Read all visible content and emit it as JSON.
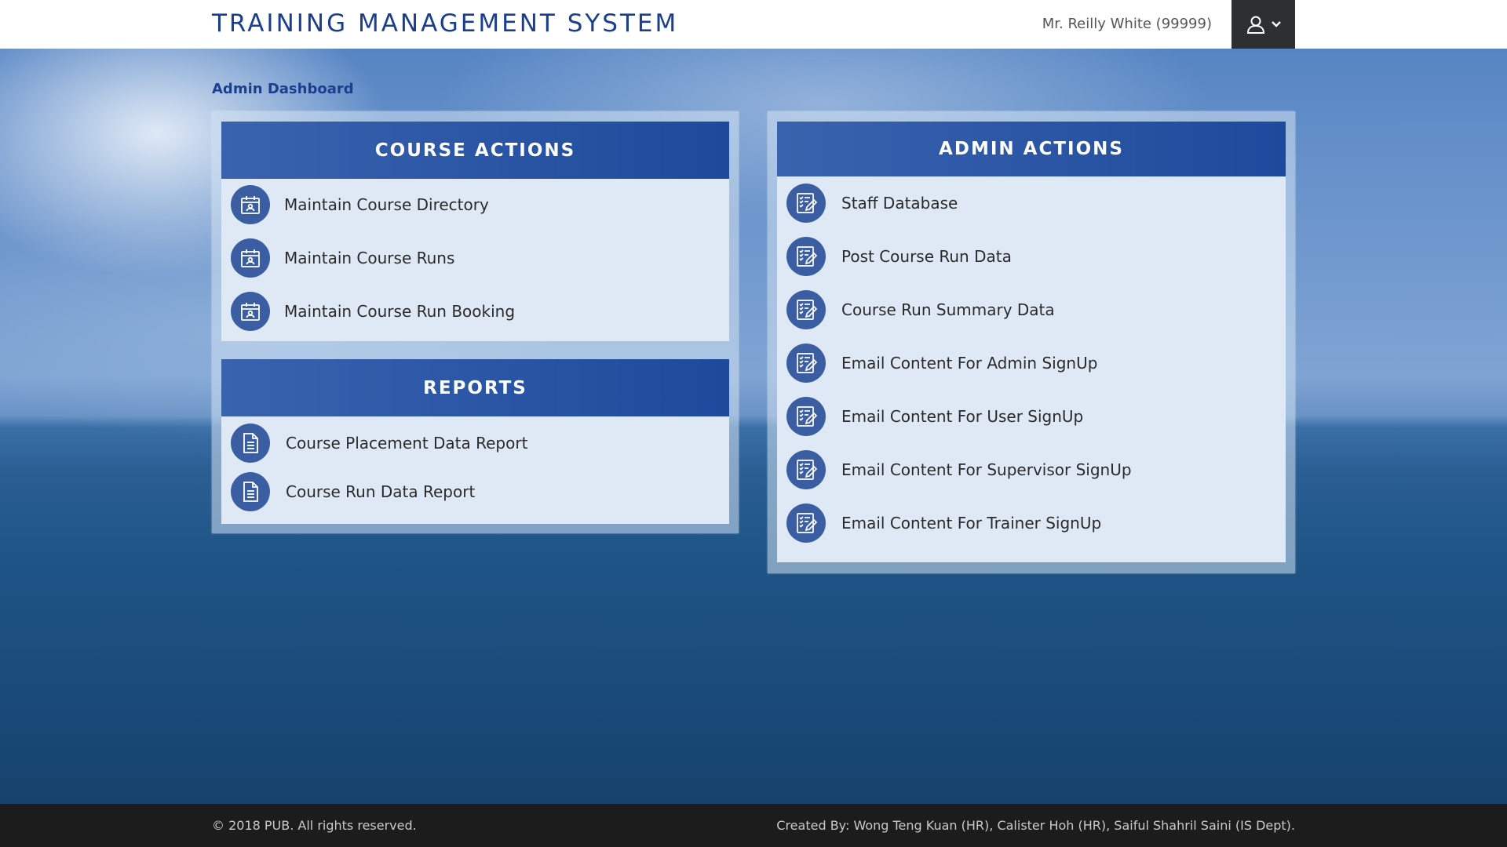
{
  "header": {
    "brand": "TRAINING MANAGEMENT SYSTEM",
    "user_name": "Mr. Reilly White (99999)",
    "user_menu_icon": "user-icon"
  },
  "page": {
    "title": "Admin Dashboard"
  },
  "course_actions": {
    "title": "COURSE ACTIONS",
    "items": [
      {
        "label": "Maintain Course Directory",
        "icon": "calendar-person-icon"
      },
      {
        "label": "Maintain Course Runs",
        "icon": "calendar-person-icon"
      },
      {
        "label": "Maintain Course Run Booking",
        "icon": "calendar-person-icon"
      }
    ]
  },
  "reports": {
    "title": "REPORTS",
    "items": [
      {
        "label": "Course Placement Data Report",
        "icon": "document-icon"
      },
      {
        "label": "Course Run Data Report",
        "icon": "document-icon"
      }
    ]
  },
  "admin_actions": {
    "title": "ADMIN ACTIONS",
    "items": [
      {
        "label": "Staff Database",
        "icon": "checklist-edit-icon"
      },
      {
        "label": "Post Course Run Data",
        "icon": "checklist-edit-icon"
      },
      {
        "label": "Course Run Summary Data",
        "icon": "checklist-edit-icon"
      },
      {
        "label": "Email Content For Admin SignUp",
        "icon": "checklist-edit-icon"
      },
      {
        "label": "Email Content For User SignUp",
        "icon": "checklist-edit-icon"
      },
      {
        "label": "Email Content For Supervisor SignUp",
        "icon": "checklist-edit-icon"
      },
      {
        "label": "Email Content For Trainer SignUp",
        "icon": "checklist-edit-icon"
      }
    ]
  },
  "footer": {
    "copyright": "© 2018 PUB. All rights reserved.",
    "credits": "Created By: Wong Teng Kuan (HR), Calister Hoh (HR), Saiful Shahril Saini (IS Dept)."
  },
  "colors": {
    "brand": "#1b3f8e",
    "panel_header": "#2f56a5",
    "icon_circle": "#3b5ea3",
    "footer_bg": "#1c1c1c"
  }
}
